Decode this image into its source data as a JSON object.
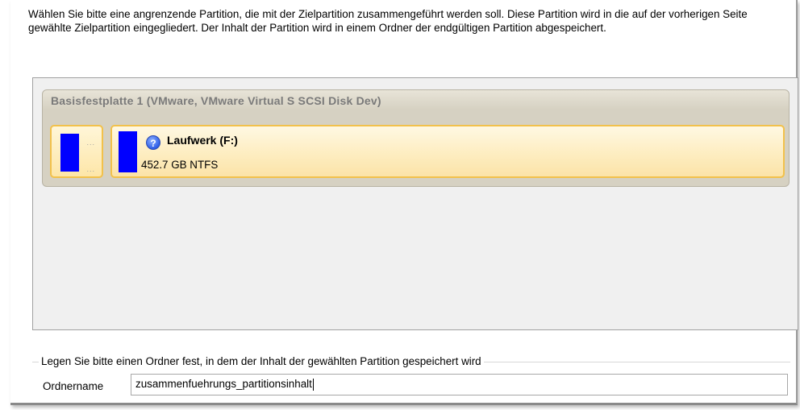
{
  "instructions": "Wählen Sie bitte eine angrenzende Partition, die mit der Zielpartition zusammengeführt werden soll. Diese Partition wird in die auf der vorherigen Seite gewählte Zielpartition eingegliedert. Der Inhalt der Partition wird in einem Ordner der endgültigen Partition abgespeichert.",
  "disk": {
    "title": "Basisfestplatte 1 (VMware, VMware Virtual S SCSI Disk Dev)",
    "partitions": [
      {
        "name": "",
        "dots_top": "...",
        "dots_bottom": "..."
      },
      {
        "name": "Laufwerk (F:)",
        "size_fs": "452.7 GB NTFS",
        "icon": "help-icon"
      }
    ]
  },
  "folder_group": {
    "label": "Legen Sie bitte einen Ordner fest, in dem der Inhalt der gewählten Partition gespeichert wird",
    "field_label": "Ordnername",
    "field_value": "zusammenfuehrungs_partitionsinhalt"
  },
  "colors": {
    "partition_bar": "#0000ff",
    "partition_border": "#f2c14b",
    "disk_title": "#7a7a7a"
  }
}
